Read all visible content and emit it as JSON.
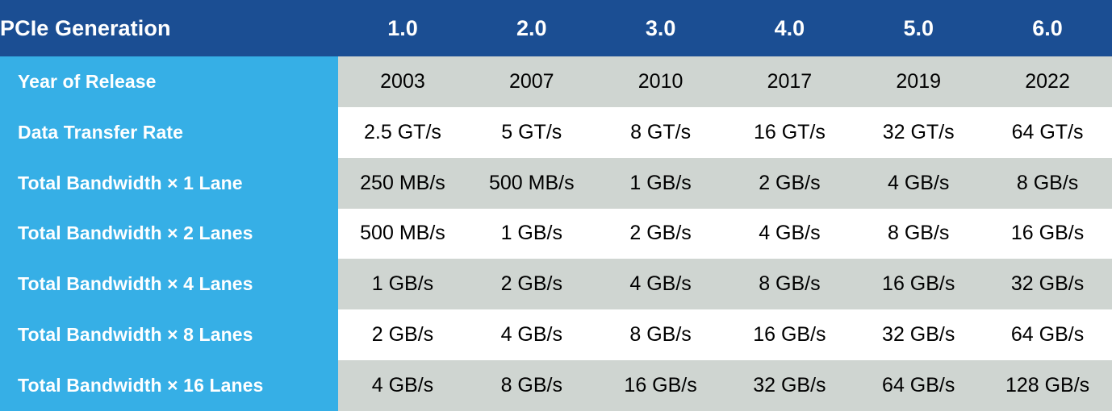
{
  "table": {
    "corner_label": "PCIe Generation",
    "colors": {
      "header_bg": "#1B4E93",
      "label_bg": "#36AFE6",
      "row_shaded_bg": "#CFD5D1",
      "row_plain_bg": "#FFFFFF",
      "header_text": "#FFFFFF",
      "label_text": "#FFFFFF",
      "cell_text": "#000000"
    },
    "columns": [
      "1.0",
      "2.0",
      "3.0",
      "4.0",
      "5.0",
      "6.0"
    ],
    "rows": [
      {
        "label": "Year of Release",
        "values": [
          "2003",
          "2007",
          "2010",
          "2017",
          "2019",
          "2022"
        ]
      },
      {
        "label": "Data Transfer Rate",
        "values": [
          "2.5 GT/s",
          "5 GT/s",
          "8 GT/s",
          "16 GT/s",
          "32 GT/s",
          "64 GT/s"
        ]
      },
      {
        "label": "Total Bandwidth × 1 Lane",
        "values": [
          "250 MB/s",
          "500 MB/s",
          "1 GB/s",
          "2 GB/s",
          "4 GB/s",
          "8 GB/s"
        ]
      },
      {
        "label": "Total Bandwidth × 2 Lanes",
        "values": [
          "500 MB/s",
          "1 GB/s",
          "2 GB/s",
          "4 GB/s",
          "8 GB/s",
          "16 GB/s"
        ]
      },
      {
        "label": "Total Bandwidth × 4 Lanes",
        "values": [
          "1 GB/s",
          "2 GB/s",
          "4 GB/s",
          "8 GB/s",
          "16 GB/s",
          "32 GB/s"
        ]
      },
      {
        "label": "Total Bandwidth × 8 Lanes",
        "values": [
          "2 GB/s",
          "4 GB/s",
          "8 GB/s",
          "16 GB/s",
          "32 GB/s",
          "64 GB/s"
        ]
      },
      {
        "label": "Total Bandwidth × 16 Lanes",
        "values": [
          "4 GB/s",
          "8 GB/s",
          "16 GB/s",
          "32 GB/s",
          "64 GB/s",
          "128 GB/s"
        ]
      }
    ]
  }
}
